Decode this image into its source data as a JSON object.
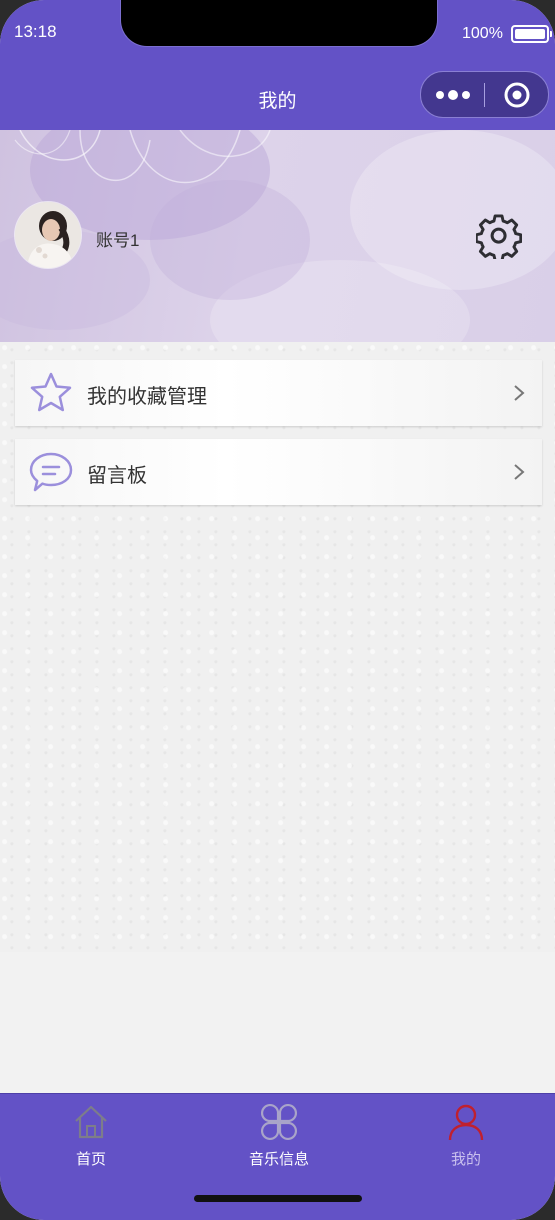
{
  "status_bar": {
    "time": "13:18",
    "battery": "100%"
  },
  "nav": {
    "title": "我的"
  },
  "profile": {
    "account_name": "账号1"
  },
  "menu": [
    {
      "label": "我的收藏管理",
      "icon": "star-icon"
    },
    {
      "label": "留言板",
      "icon": "chat-bubble-icon"
    }
  ],
  "tabbar": [
    {
      "label": "首页",
      "icon": "house-icon",
      "active": false
    },
    {
      "label": "音乐信息",
      "icon": "clover-icon",
      "active": false
    },
    {
      "label": "我的",
      "icon": "user-icon",
      "active": true
    }
  ],
  "colors": {
    "brand": "#6352c6",
    "active_tab_icon": "#c0202e",
    "menu_icon": "#9b8fdc"
  }
}
